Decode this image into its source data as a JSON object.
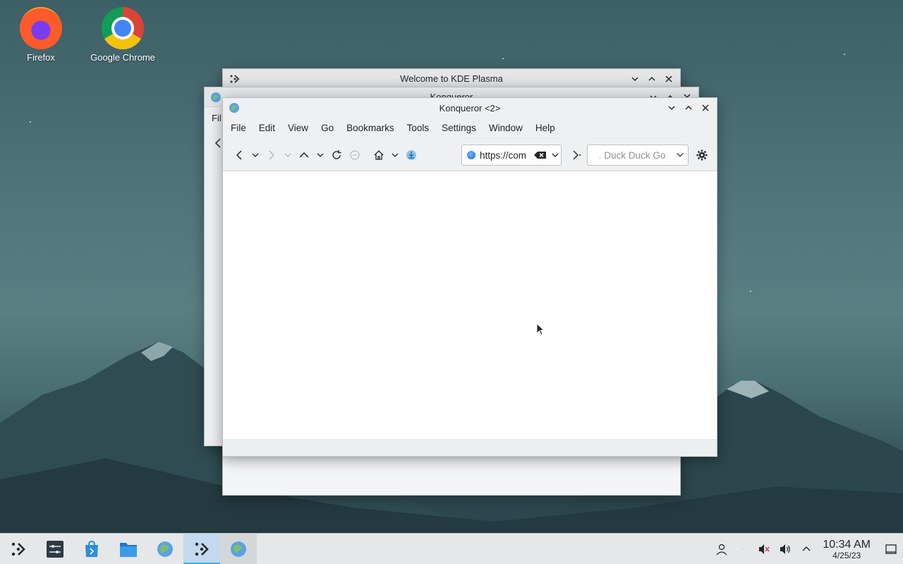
{
  "desktop": {
    "icons": [
      {
        "label": "Firefox",
        "icon": "firefox-icon"
      },
      {
        "label": "Google Chrome",
        "icon": "chrome-icon"
      }
    ]
  },
  "windows": {
    "welcome": {
      "title": "Welcome to KDE Plasma"
    },
    "konqueror_back": {
      "title": "Konqueror",
      "menu_peek": "Fil"
    },
    "konqueror_main": {
      "title": "Konqueror <2>",
      "menu": [
        "File",
        "Edit",
        "View",
        "Go",
        "Bookmarks",
        "Tools",
        "Settings",
        "Window",
        "Help"
      ],
      "url": "https://com",
      "search_placeholder": "Duck Duck Go",
      "search_prefix": "¸"
    }
  },
  "taskbar": {
    "clock": {
      "time": "10:34 AM",
      "date": "4/25/23"
    },
    "tasks": [
      "app-launcher-icon",
      "system-settings-icon",
      "discover-icon",
      "dolphin-icon",
      "konqueror-icon",
      "welcome-center-icon",
      "konqueror-icon"
    ],
    "tray": [
      "user-icon",
      "network-icon",
      "audio-muted-icon",
      "volume-icon",
      "tray-expand-icon"
    ]
  },
  "colors": {
    "accent": "#3daee9",
    "panel": "#e5e7e9",
    "titlebar": "#e3e5e7"
  }
}
